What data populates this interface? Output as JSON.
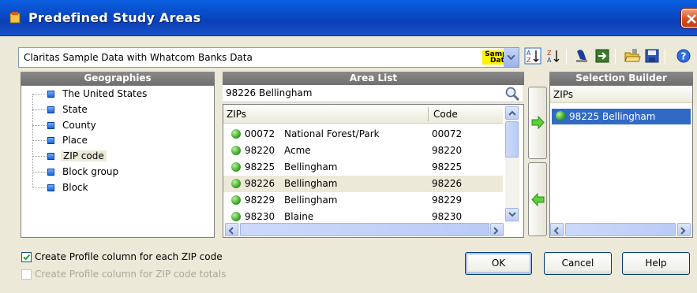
{
  "window": {
    "title": "Predefined Study Areas"
  },
  "toolbar": {
    "dataset_value": "Claritas Sample Data with Whatcom Banks Data",
    "sample_badge": "Sample Data",
    "icons": [
      "sort-ascending-icon",
      "sort-descending-icon",
      "map-pin-icon",
      "export-icon",
      "open-folder-icon",
      "save-icon",
      "help-icon"
    ]
  },
  "geographies": {
    "header": "Geographies",
    "items": [
      {
        "label": "The United States"
      },
      {
        "label": "State"
      },
      {
        "label": "County"
      },
      {
        "label": "Place"
      },
      {
        "label": "ZIP code",
        "selected": true
      },
      {
        "label": "Block group"
      },
      {
        "label": "Block"
      }
    ]
  },
  "area_list": {
    "header": "Area List",
    "search_value": "98226  Bellingham",
    "columns": [
      "ZIPs",
      "Code"
    ],
    "rows": [
      {
        "zip": "00072",
        "place": "National Forest/Park",
        "code": "00072"
      },
      {
        "zip": "98220",
        "place": "Acme",
        "code": "98220"
      },
      {
        "zip": "98225",
        "place": "Bellingham",
        "code": "98225"
      },
      {
        "zip": "98226",
        "place": "Bellingham",
        "code": "98226",
        "selected": true
      },
      {
        "zip": "98229",
        "place": "Bellingham",
        "code": "98229"
      },
      {
        "zip": "98230",
        "place": "Blaine",
        "code": "98230"
      }
    ]
  },
  "selection_builder": {
    "header": "Selection Builder",
    "column": "ZIPs",
    "items": [
      {
        "label": "98225  Bellingham"
      }
    ]
  },
  "options": {
    "profile_each": {
      "label": "Create Profile column for each ZIP code",
      "checked": true
    },
    "profile_totals": {
      "label": "Create Profile column for ZIP code totals",
      "checked": false,
      "disabled": true
    }
  },
  "buttons": {
    "ok": "OK",
    "cancel": "Cancel",
    "help": "Help"
  },
  "colors": {
    "titlebar": "#0a4ed0",
    "selection": "#316ac5",
    "dialog_bg": "#ece9d8",
    "badge": "#fff200"
  }
}
